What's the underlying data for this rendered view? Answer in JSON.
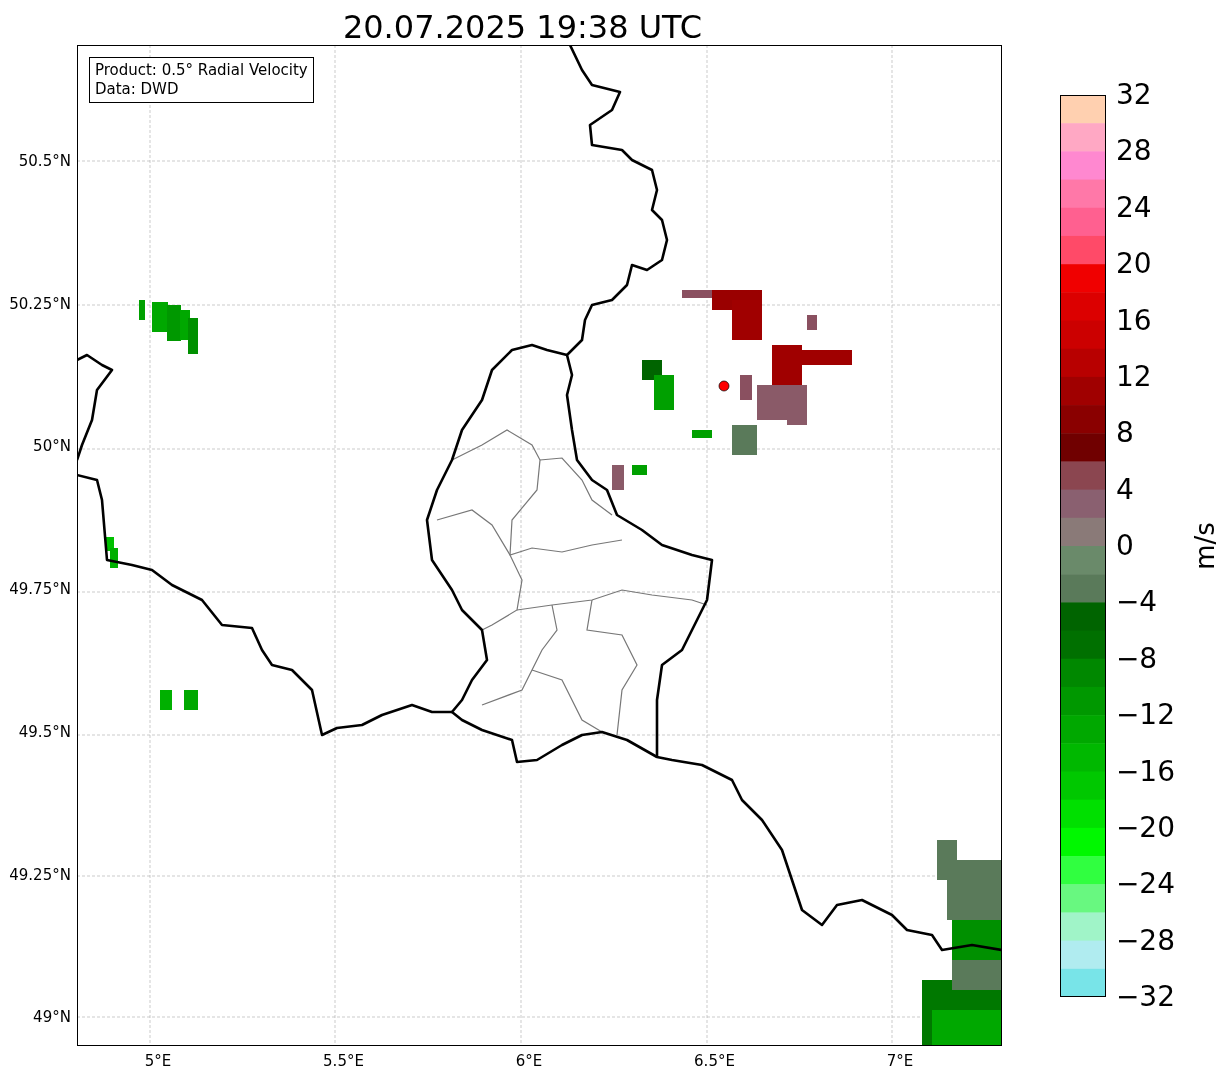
{
  "title": "20.07.2025 19:38 UTC",
  "legend": {
    "lines": [
      "Product: 0.5° Radial Velocity",
      "Data: DWD"
    ]
  },
  "map": {
    "y_ticks": [
      "50.5°N",
      "50.25°N",
      "50°N",
      "49.75°N",
      "49.5°N",
      "49.25°N",
      "49°N"
    ],
    "x_ticks": [
      "5°E",
      "5.5°E",
      "6°E",
      "6.5°E",
      "7°E"
    ]
  },
  "colorbar": {
    "label": "m/s",
    "ticks": [
      "32",
      "28",
      "24",
      "20",
      "16",
      "12",
      "8",
      "4",
      "0",
      "−4",
      "−8",
      "−12",
      "−16",
      "−20",
      "−24",
      "−28",
      "−32"
    ]
  }
}
